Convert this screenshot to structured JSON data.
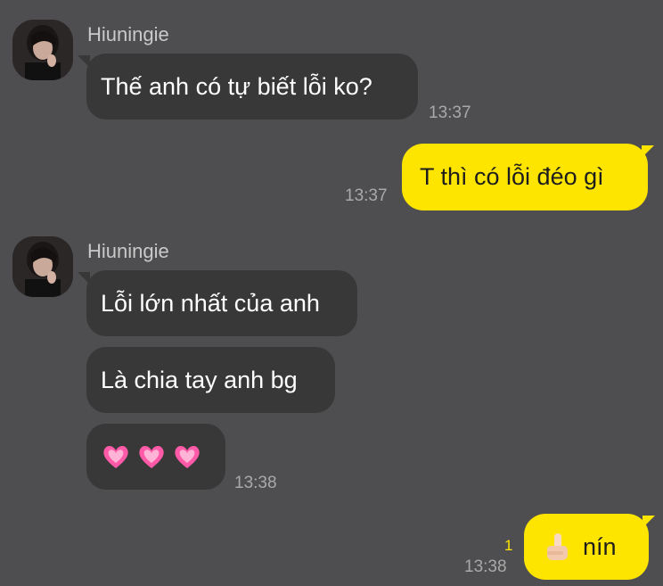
{
  "messages": [
    {
      "sender": "Hiuningie",
      "text": "Thế anh có tự biết lỗi ko?",
      "time": "13:37"
    },
    {
      "text": "T thì có lỗi đéo gì",
      "time": "13:37"
    },
    {
      "sender": "Hiuningie",
      "texts": [
        "Lỗi lớn nhất của anh",
        "Là chia tay anh bg"
      ],
      "hearts": 3,
      "time": "13:38"
    },
    {
      "text": "nín",
      "time": "13:38",
      "unread": "1"
    }
  ],
  "colors": {
    "background": "#4e4e50",
    "incoming": "#383839",
    "outgoing": "#fee500",
    "heart": "#ff4fa3"
  },
  "icons": [
    "avatar",
    "heart-icon",
    "pointing-finger-icon"
  ]
}
